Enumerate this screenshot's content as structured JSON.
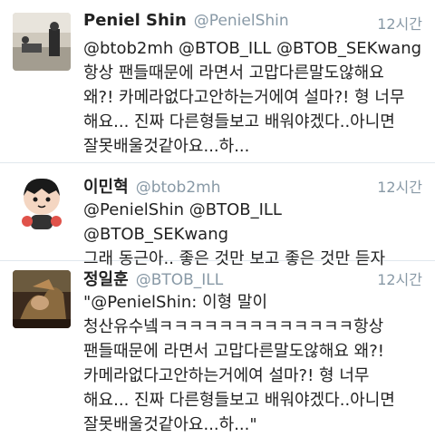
{
  "tweets": [
    {
      "name": "Peniel Shin",
      "handle": "@PenielShin",
      "time": "12시간",
      "text": "@btob2mh @BTOB_ILL @BTOB_SEKwang\n항상 팬들때문에 라면서 고맙다른말도않해요\n왜?! 카메라없다고안하는거에여 설마?! 형 너무\n해요... 진짜 다른형들보고 배워야겠다..아니면\n잘못배울것같아요...하..."
    },
    {
      "name": "이민혁",
      "handle": "@btob2mh",
      "time": "12시간",
      "text": "@PenielShin @BTOB_ILL @BTOB_SEKwang\n그래 동근아.. 좋은 것만 보고 좋은 것만 듣자"
    },
    {
      "name": "정일훈",
      "handle": "@BTOB_ILL",
      "time": "12시간",
      "text": "\"@PenielShin: 이형 말이\n청산유수넼ㅋㅋㅋㅋㅋㅋㅋㅋㅋㅋㅋㅋㅋ항상\n팬들때문에 라면서 고맙다른말도않해요 왜?!\n카메라없다고안하는거에여 설마?! 형 너무\n해요... 진짜 다른형들보고 배워야겠다..아니면\n잘못배울것같아요...하...\""
    }
  ],
  "colors": {
    "name": "#222222",
    "meta": "#8899a6",
    "divider": "#e1e8ed"
  }
}
